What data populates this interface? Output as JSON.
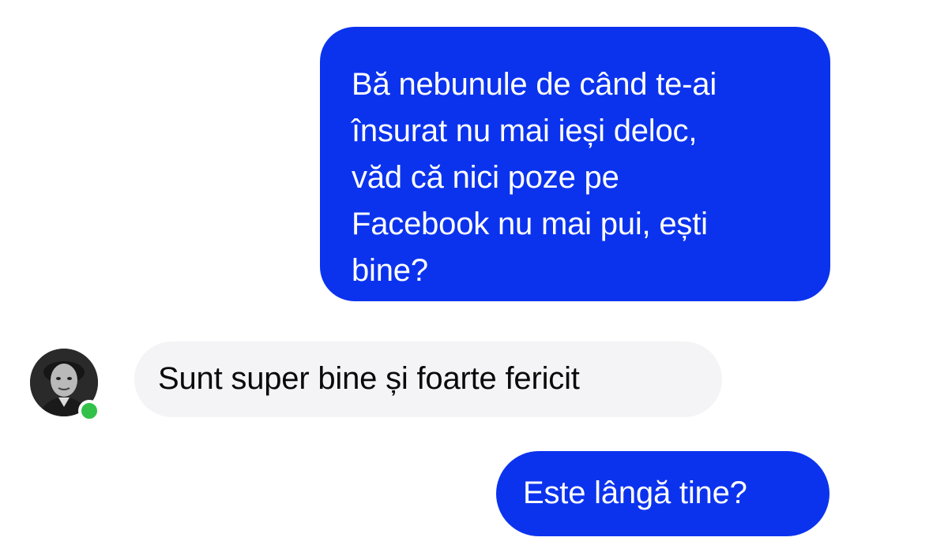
{
  "conversation": {
    "messages": [
      {
        "direction": "outgoing",
        "text": "Bă nebunule de când te-ai\nînsurat nu mai ieși deloc,\nvăd că nici poze pe\nFacebook nu mai pui, ești\nbine?"
      },
      {
        "direction": "incoming",
        "text": "Sunt super bine și foarte fericit"
      },
      {
        "direction": "outgoing",
        "text": "Este lângă tine?"
      }
    ],
    "contact": {
      "avatar_icon": "person-photo-avatar",
      "status": "online",
      "status_color": "#33c14a"
    }
  },
  "colors": {
    "outgoing_bubble": "#0b33ee",
    "incoming_bubble": "#f4f4f6",
    "background": "#ffffff"
  }
}
